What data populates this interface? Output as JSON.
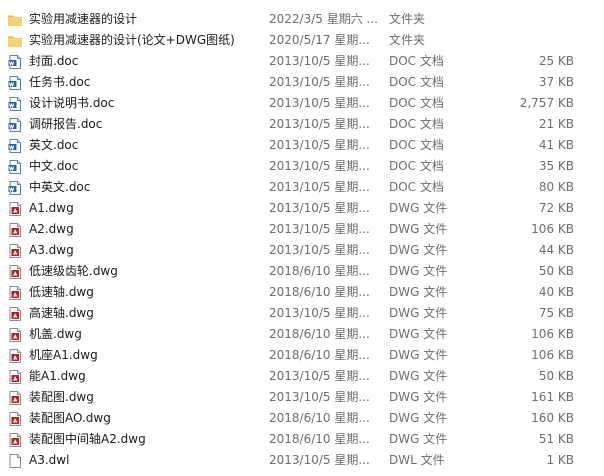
{
  "files": [
    {
      "name": "实验用减速器的设计",
      "date": "2022/3/5 星期六 ...",
      "type": "文件夹",
      "size": "",
      "icon": "folder-icon"
    },
    {
      "name": "实验用减速器的设计(论文+DWG图纸)",
      "date": "2020/5/17 星期...",
      "type": "文件夹",
      "size": "",
      "icon": "folder-icon"
    },
    {
      "name": "封面.doc",
      "date": "2013/10/5 星期...",
      "type": "DOC 文档",
      "size": "25 KB",
      "icon": "doc-file-icon"
    },
    {
      "name": "任务书.doc",
      "date": "2013/10/5 星期...",
      "type": "DOC 文档",
      "size": "37 KB",
      "icon": "doc-file-icon"
    },
    {
      "name": "设计说明书.doc",
      "date": "2013/10/5 星期...",
      "type": "DOC 文档",
      "size": "2,757 KB",
      "icon": "doc-file-icon"
    },
    {
      "name": "调研报告.doc",
      "date": "2013/10/5 星期...",
      "type": "DOC 文档",
      "size": "21 KB",
      "icon": "doc-file-icon"
    },
    {
      "name": "英文.doc",
      "date": "2013/10/5 星期...",
      "type": "DOC 文档",
      "size": "41 KB",
      "icon": "doc-file-icon"
    },
    {
      "name": "中文.doc",
      "date": "2013/10/5 星期...",
      "type": "DOC 文档",
      "size": "35 KB",
      "icon": "doc-file-icon"
    },
    {
      "name": "中英文.doc",
      "date": "2013/10/5 星期...",
      "type": "DOC 文档",
      "size": "80 KB",
      "icon": "doc-file-icon"
    },
    {
      "name": "A1.dwg",
      "date": "2013/10/5 星期...",
      "type": "DWG 文件",
      "size": "72 KB",
      "icon": "dwg-file-icon"
    },
    {
      "name": "A2.dwg",
      "date": "2013/10/5 星期...",
      "type": "DWG 文件",
      "size": "106 KB",
      "icon": "dwg-file-icon"
    },
    {
      "name": "A3.dwg",
      "date": "2013/10/5 星期...",
      "type": "DWG 文件",
      "size": "44 KB",
      "icon": "dwg-file-icon"
    },
    {
      "name": "低速级齿轮.dwg",
      "date": "2018/6/10 星期...",
      "type": "DWG 文件",
      "size": "50 KB",
      "icon": "dwg-file-icon"
    },
    {
      "name": "低速轴.dwg",
      "date": "2018/6/10 星期...",
      "type": "DWG 文件",
      "size": "40 KB",
      "icon": "dwg-file-icon"
    },
    {
      "name": "高速轴.dwg",
      "date": "2013/10/5 星期...",
      "type": "DWG 文件",
      "size": "75 KB",
      "icon": "dwg-file-icon"
    },
    {
      "name": "机盖.dwg",
      "date": "2018/6/10 星期...",
      "type": "DWG 文件",
      "size": "106 KB",
      "icon": "dwg-file-icon"
    },
    {
      "name": "机座A1.dwg",
      "date": "2018/6/10 星期...",
      "type": "DWG 文件",
      "size": "106 KB",
      "icon": "dwg-file-icon"
    },
    {
      "name": "能A1.dwg",
      "date": "2013/10/5 星期...",
      "type": "DWG 文件",
      "size": "50 KB",
      "icon": "dwg-file-icon"
    },
    {
      "name": "装配图.dwg",
      "date": "2013/10/5 星期...",
      "type": "DWG 文件",
      "size": "161 KB",
      "icon": "dwg-file-icon"
    },
    {
      "name": "装配图AO.dwg",
      "date": "2018/6/10 星期...",
      "type": "DWG 文件",
      "size": "160 KB",
      "icon": "dwg-file-icon"
    },
    {
      "name": "装配图中间轴A2.dwg",
      "date": "2018/6/10 星期...",
      "type": "DWG 文件",
      "size": "51 KB",
      "icon": "dwg-file-icon"
    },
    {
      "name": "A3.dwl",
      "date": "2013/10/5 星期...",
      "type": "DWL 文件",
      "size": "1 KB",
      "icon": "generic-file-icon"
    }
  ]
}
